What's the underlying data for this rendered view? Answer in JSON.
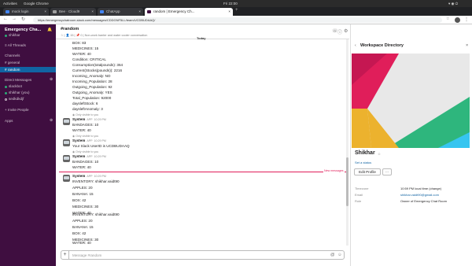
{
  "os": {
    "activities": "Activities",
    "app_name": "Google Chrome",
    "clock": "Fri 22:00"
  },
  "browser": {
    "tabs": [
      {
        "label": "mock login"
      },
      {
        "label": "Bee · Cloud9"
      },
      {
        "label": "ChatApp"
      },
      {
        "label": "random | Emergency Ch..."
      }
    ],
    "url": "https://emergencychatroom.slack.com/messages/CDDGNF5LL/team/UCDBUDAAQ/"
  },
  "sidebar": {
    "workspace": "Emergency Cha...",
    "user": "shikhar",
    "all_threads": "All Threads",
    "channels_heading": "Channels",
    "channels": [
      "# general",
      "# random"
    ],
    "dm_heading": "Direct Messages",
    "dms": [
      "slackbot",
      "shikhar (you)",
      "sedkdkdjf"
    ],
    "invite": "+ Invite People",
    "apps": "Apps"
  },
  "channel": {
    "name": "#random",
    "meta": "☆ | 👤 15 | 📌 0 | Non-work banter and water cooler conversation",
    "today": "Today",
    "search_placeholder": "Search",
    "new_messages": "New messages",
    "composer_placeholder": "Message #random"
  },
  "messages": {
    "block1": [
      "BOX: 83",
      "MEDICINES: 15",
      "WATER: 40",
      "",
      "Condition: CRITICAL",
      "Consumption(totalpounds): 364",
      "Current(Stocks(pounds)): 2216",
      "Incoming_Anomaly: NO",
      "Incoming_Population: 28",
      "Outgoing_Population: 92",
      "Outgoing_Anomaly: YES",
      "Total_Population: 92000",
      "daysleftStock: 6",
      "daysleftAnomaly: 3"
    ],
    "only_visible": "Only visible to you",
    "system_name": "System",
    "app_badge": "APP",
    "time1": "10:29 PM",
    "m2": [
      "BANDAGES: 10",
      "WATER: 40"
    ],
    "time2": "10:29 PM",
    "m3": [
      "Your Slack UserID is UCDBUDAAQ"
    ],
    "time3": "10:29 PM",
    "m4": [
      "BANDAGES: 10",
      "WATER: 40"
    ],
    "time4": "10:29 PM",
    "m5": [
      "INVENTORY: shikhar.vaidt90",
      "APPLES: 20",
      "BANANA: 15",
      "BOX: 42",
      "MEDICINES: 30",
      "WATER: 40",
      "",
      "INVENTORY: shikhar.vaidt90",
      "APPLES: 20",
      "BANANA: 15",
      "BOX: 42",
      "MEDICINES: 30",
      "WATER: 40"
    ]
  },
  "profile": {
    "title": "Workspace Directory",
    "name": "Shikhar",
    "set_status": "Set a status",
    "edit_button": "Edit Profile",
    "more_button": "···",
    "fields": [
      {
        "label": "Timezone",
        "value": "10:59 PM local time (change)"
      },
      {
        "label": "Email",
        "value": "shikhar.vaidt90@gmail.com"
      },
      {
        "label": "Role",
        "value": "Owner of Emergency Chat Room"
      }
    ]
  },
  "colors": {
    "sidebar": "#3f0e40",
    "selected": "#1164a3",
    "online": "#2bac76",
    "new_messages": "#e01e5a"
  }
}
